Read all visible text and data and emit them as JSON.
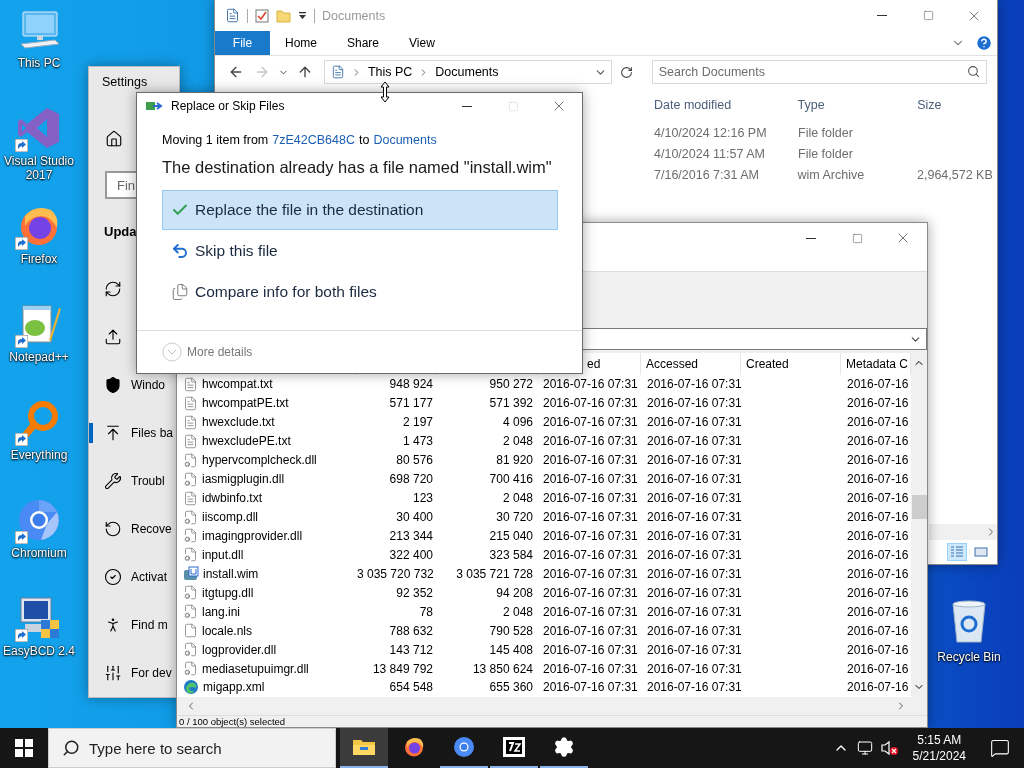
{
  "desktop": {
    "icons": [
      {
        "kind": "computer",
        "label": "This PC",
        "shortcut": false
      },
      {
        "kind": "visual-studio",
        "label": "Visual Studio 2017",
        "shortcut": true
      },
      {
        "kind": "firefox",
        "label": "Firefox",
        "shortcut": true
      },
      {
        "kind": "notepad",
        "label": "Notepad++",
        "shortcut": true
      },
      {
        "kind": "everything",
        "label": "Everything",
        "shortcut": true
      },
      {
        "kind": "chromium",
        "label": "Chromium",
        "shortcut": true
      },
      {
        "kind": "easybcd",
        "label": "EasyBCD 2.4",
        "shortcut": true
      }
    ],
    "recycle_bin": {
      "label": "Recycle Bin"
    }
  },
  "settings_window": {
    "title": "Settings",
    "search": {
      "placeholder": "Fin"
    },
    "heading": "Upda",
    "nav": [
      {
        "kind": "sync",
        "selected": false
      },
      {
        "kind": "delivery",
        "selected": false
      },
      {
        "kind": "security",
        "label": "Windo",
        "selected": false
      },
      {
        "kind": "backup",
        "label": "Files ba",
        "selected": true
      },
      {
        "kind": "troubleshoot",
        "label": "Troubl",
        "selected": false
      },
      {
        "kind": "recovery",
        "label": "Recove",
        "selected": false
      },
      {
        "kind": "activation",
        "label": "Activat",
        "selected": false
      },
      {
        "kind": "find-device",
        "label": "Find m",
        "selected": false
      },
      {
        "kind": "developers",
        "label": "For dev",
        "selected": false
      }
    ]
  },
  "explorer": {
    "title": "Documents",
    "file_tab": "File",
    "tabs": [
      "Home",
      "Share",
      "View"
    ],
    "address": [
      "This PC",
      "Documents"
    ],
    "search": {
      "placeholder": "Search Documents"
    },
    "columns": [
      "Date modified",
      "Type",
      "Size"
    ],
    "rows": [
      {
        "date_modified": "4/10/2024 12:16 PM",
        "type": "File folder"
      },
      {
        "date_modified": "4/10/2024 11:57 AM",
        "type": "File folder"
      },
      {
        "date_modified": "7/16/2016 7:31 AM",
        "type": "wim Archive",
        "size": "2,964,572 KB"
      }
    ]
  },
  "archive_window": {
    "columns": [
      "ed",
      "Accessed",
      "Created",
      "Metadata C"
    ],
    "rows": [
      {
        "kind": "text",
        "name": "hwcompat.txt",
        "size": "948 924",
        "packed_size": "950 272",
        "modified": "2016-07-16 07:31",
        "accessed": "2016-07-16 07:31",
        "metadata_changed": "2016-07-16"
      },
      {
        "kind": "text",
        "name": "hwcompatPE.txt",
        "size": "571 177",
        "packed_size": "571 392",
        "modified": "2016-07-16 07:31",
        "accessed": "2016-07-16 07:31",
        "metadata_changed": "2016-07-16"
      },
      {
        "kind": "text",
        "name": "hwexclude.txt",
        "size": "2 197",
        "packed_size": "4 096",
        "modified": "2016-07-16 07:31",
        "accessed": "2016-07-16 07:31",
        "metadata_changed": "2016-07-16"
      },
      {
        "kind": "text",
        "name": "hwexcludePE.txt",
        "size": "1 473",
        "packed_size": "2 048",
        "modified": "2016-07-16 07:31",
        "accessed": "2016-07-16 07:31",
        "metadata_changed": "2016-07-16"
      },
      {
        "kind": "dll",
        "name": "hypervcomplcheck.dll",
        "size": "80 576",
        "packed_size": "81 920",
        "modified": "2016-07-16 07:31",
        "accessed": "2016-07-16 07:31",
        "metadata_changed": "2016-07-16"
      },
      {
        "kind": "dll",
        "name": "iasmigplugin.dll",
        "size": "698 720",
        "packed_size": "700 416",
        "modified": "2016-07-16 07:31",
        "accessed": "2016-07-16 07:31",
        "metadata_changed": "2016-07-16"
      },
      {
        "kind": "text",
        "name": "idwbinfo.txt",
        "size": "123",
        "packed_size": "2 048",
        "modified": "2016-07-16 07:31",
        "accessed": "2016-07-16 07:31",
        "metadata_changed": "2016-07-16"
      },
      {
        "kind": "dll",
        "name": "iiscomp.dll",
        "size": "30 400",
        "packed_size": "30 720",
        "modified": "2016-07-16 07:31",
        "accessed": "2016-07-16 07:31",
        "metadata_changed": "2016-07-16"
      },
      {
        "kind": "dll",
        "name": "imagingprovider.dll",
        "size": "213 344",
        "packed_size": "215 040",
        "modified": "2016-07-16 07:31",
        "accessed": "2016-07-16 07:31",
        "metadata_changed": "2016-07-16"
      },
      {
        "kind": "dll",
        "name": "input.dll",
        "size": "322 400",
        "packed_size": "323 584",
        "modified": "2016-07-16 07:31",
        "accessed": "2016-07-16 07:31",
        "metadata_changed": "2016-07-16"
      },
      {
        "kind": "archive",
        "name": "install.wim",
        "size": "3 035 720 732",
        "packed_size": "3 035 721 728",
        "modified": "2016-07-16 07:31",
        "accessed": "2016-07-16 07:31",
        "metadata_changed": "2016-07-16"
      },
      {
        "kind": "dll",
        "name": "itgtupg.dll",
        "size": "92 352",
        "packed_size": "94 208",
        "modified": "2016-07-16 07:31",
        "accessed": "2016-07-16 07:31",
        "metadata_changed": "2016-07-16"
      },
      {
        "kind": "config",
        "name": "lang.ini",
        "size": "78",
        "packed_size": "2 048",
        "modified": "2016-07-16 07:31",
        "accessed": "2016-07-16 07:31",
        "metadata_changed": "2016-07-16"
      },
      {
        "kind": "blank",
        "name": "locale.nls",
        "size": "788 632",
        "packed_size": "790 528",
        "modified": "2016-07-16 07:31",
        "accessed": "2016-07-16 07:31",
        "metadata_changed": "2016-07-16"
      },
      {
        "kind": "dll",
        "name": "logprovider.dll",
        "size": "143 712",
        "packed_size": "145 408",
        "modified": "2016-07-16 07:31",
        "accessed": "2016-07-16 07:31",
        "metadata_changed": "2016-07-16"
      },
      {
        "kind": "dll",
        "name": "mediasetupuimgr.dll",
        "size": "13 849 792",
        "packed_size": "13 850 624",
        "modified": "2016-07-16 07:31",
        "accessed": "2016-07-16 07:31",
        "metadata_changed": "2016-07-16"
      },
      {
        "kind": "browser",
        "name": "migapp.xml",
        "size": "654 548",
        "packed_size": "655 360",
        "modified": "2016-07-16 07:31",
        "accessed": "2016-07-16 07:31",
        "metadata_changed": "2016-07-16"
      }
    ],
    "status": "0 / 100 object(s) selected"
  },
  "dialog": {
    "title": "Replace or Skip Files",
    "moving": {
      "prefix": "Moving 1 item from",
      "source": "7zE42CB648C",
      "middle": "to",
      "destination": "Documents"
    },
    "heading": "The destination already has a file named \"install.wim\"",
    "options": [
      {
        "kind": "replace",
        "label": "Replace the file in the destination",
        "selected": true
      },
      {
        "kind": "skip",
        "label": "Skip this file",
        "selected": false
      },
      {
        "kind": "compare",
        "label": "Compare info for both files",
        "selected": false
      }
    ],
    "more_details": "More details"
  },
  "taskbar": {
    "search": {
      "placeholder": "Type here to search"
    },
    "apps": [
      {
        "kind": "explorer",
        "active": true,
        "running": true
      },
      {
        "kind": "firefox",
        "active": false,
        "running": false
      },
      {
        "kind": "chromium",
        "active": false,
        "running": true
      },
      {
        "kind": "archiver",
        "active": false,
        "running": true
      },
      {
        "kind": "settings",
        "active": false,
        "running": true
      }
    ],
    "volume_muted": true,
    "clock": {
      "time": "5:15 AM",
      "date": "5/21/2024"
    }
  }
}
